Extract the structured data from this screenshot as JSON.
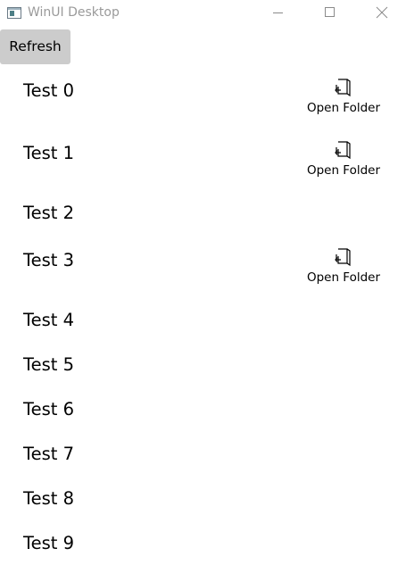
{
  "window": {
    "title": "WinUI Desktop",
    "controls": {
      "minimize": "minimize-icon",
      "maximize": "maximize-icon",
      "close": "close-icon"
    }
  },
  "toolbar": {
    "refresh_label": "Refresh"
  },
  "items": [
    {
      "label": "Test 0",
      "has_folder": true,
      "folder_label": "Open Folder"
    },
    {
      "label": "Test 1",
      "has_folder": true,
      "folder_label": "Open Folder"
    },
    {
      "label": "Test 2",
      "has_folder": false
    },
    {
      "label": "Test 3",
      "has_folder": true,
      "folder_label": "Open Folder"
    },
    {
      "label": "Test 4",
      "has_folder": false
    },
    {
      "label": "Test 5",
      "has_folder": false
    },
    {
      "label": "Test 6",
      "has_folder": false
    },
    {
      "label": "Test 7",
      "has_folder": false
    },
    {
      "label": "Test 8",
      "has_folder": false
    },
    {
      "label": "Test 9",
      "has_folder": false
    }
  ],
  "colors": {
    "button_bg": "#cccccc",
    "title_text": "#9a9a9a",
    "background": "#ffffff"
  }
}
